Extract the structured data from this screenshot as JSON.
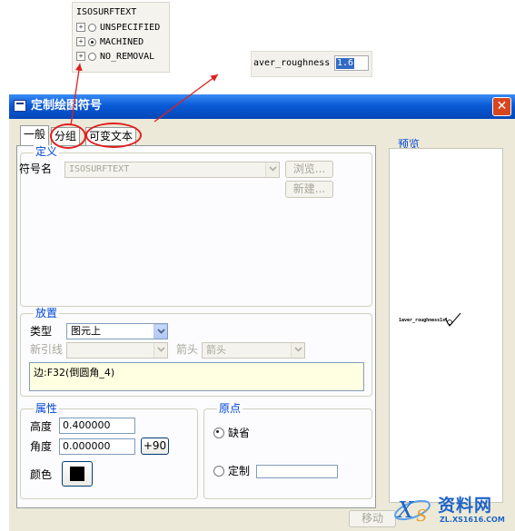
{
  "tree": {
    "title": "ISOSURFTEXT",
    "items": [
      {
        "label": "UNSPECIFIED",
        "selected": false
      },
      {
        "label": "MACHINED",
        "selected": true
      },
      {
        "label": "NO_REMOVAL",
        "selected": false
      }
    ]
  },
  "param": {
    "name": "aver_roughness",
    "value": "1.6"
  },
  "dialog": {
    "title": "定制绘图符号",
    "close_glyph": "✕",
    "tabs": [
      {
        "label": "一般",
        "active": true
      },
      {
        "label": "分组",
        "active": false
      },
      {
        "label": "可变文本",
        "active": false
      }
    ],
    "definition": {
      "legend": "定义",
      "symbol_name_label": "符号名",
      "symbol_name_value": "ISOSURFTEXT",
      "browse_button": "浏览...",
      "new_button": "新建..."
    },
    "placement": {
      "legend": "放置",
      "type_label": "类型",
      "type_value": "图元上",
      "leader_label": "新引线",
      "leader_value": "",
      "arrow_label": "箭头",
      "arrow_value": "箭头",
      "reference_text": "边:F32(倒圆角_4)"
    },
    "properties": {
      "legend": "属性",
      "height_label": "高度",
      "height_value": "0.400000",
      "angle_label": "角度",
      "angle_value": "0.000000",
      "angle_button": "+90",
      "color_label": "颜色",
      "color_value": "#000000"
    },
    "origin": {
      "legend": "原点",
      "default_label": "缺省",
      "default_selected": true,
      "custom_label": "定制",
      "custom_value": ""
    },
    "preview": {
      "legend": "预览",
      "symbol_text": "1aver_roughness1sl"
    },
    "move_button": "移动"
  },
  "watermark": {
    "brand": "资料网",
    "url": "ZL.XS1616.COM"
  },
  "colors": {
    "title_bar": "#0a5ad6",
    "legend_blue": "#0046d5",
    "annotation_red": "#e02020",
    "close_button": "#d8461f"
  }
}
